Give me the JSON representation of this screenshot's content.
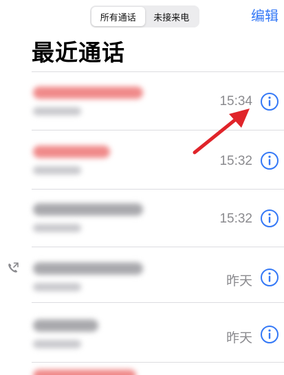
{
  "segmented": {
    "all_label": "所有通话",
    "missed_label": "未接来电",
    "selected": "all"
  },
  "header": {
    "edit_label": "编辑",
    "title": "最近通话"
  },
  "calls": [
    {
      "time": "15:34",
      "name_color": "#f08a8a",
      "missed": true
    },
    {
      "time": "15:32",
      "name_color": "#f08a8a",
      "missed": true
    },
    {
      "time": "15:32",
      "name_color": "#a9a9ad",
      "missed": false
    },
    {
      "time": "昨天",
      "name_color": "#a9a9ad",
      "missed": false,
      "outgoing_icon": "outgoing-call-icon"
    },
    {
      "time": "昨天",
      "name_color": "#a9a9ad",
      "missed": false
    }
  ],
  "colors": {
    "accent": "#3478f6",
    "missed": "#f08a8a",
    "secondary_text": "#8a8a8e",
    "annotation_arrow": "#e0242a"
  },
  "icons": {
    "info": "info-circle-icon",
    "outgoing": "outgoing-call-icon",
    "annotation": "red-arrow-annotation"
  }
}
